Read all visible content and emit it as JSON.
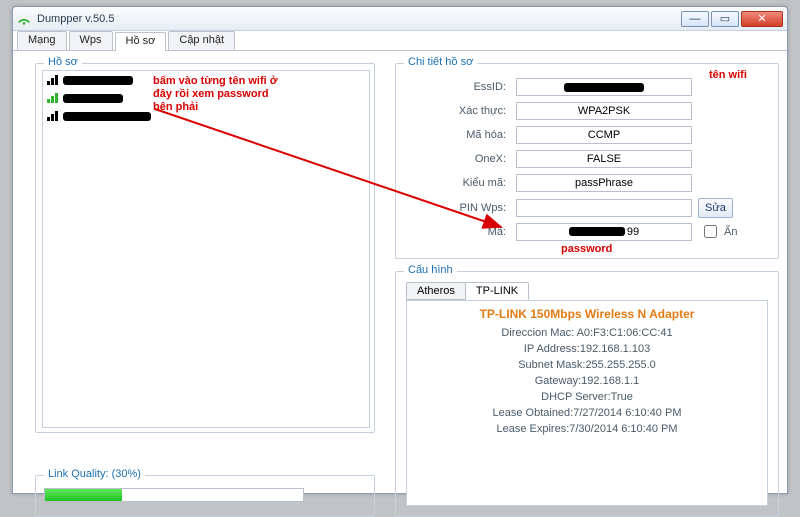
{
  "window": {
    "title": "Dumpper v.50.5"
  },
  "tabs": [
    "Mạng",
    "Wps",
    "Hồ sơ",
    "Cập nhật"
  ],
  "profilesGroup": {
    "legend": "Hồ sơ",
    "items": [
      {
        "signal": "black",
        "redact_w": 70
      },
      {
        "signal": "green",
        "redact_w": 60
      },
      {
        "signal": "black",
        "redact_w": 88
      }
    ]
  },
  "linkGroup": {
    "legend": "Link Quality: (30%)",
    "percent": 30
  },
  "details": {
    "legend": "Chi tiết hồ sơ",
    "fields": {
      "essid_label": "EssID:",
      "essid_redact_w": 80,
      "auth_label": "Xác thực:",
      "auth_value": "WPA2PSK",
      "enc_label": "Mã hóa:",
      "enc_value": "CCMP",
      "onex_label": "OneX:",
      "onex_value": "FALSE",
      "keytype_label": "Kiểu mã:",
      "keytype_value": "passPhrase",
      "pin_label": "PIN Wps:",
      "pin_value": "",
      "edit_btn": "Sửa",
      "pw_label": "Mã:",
      "pw_redact_w": 56,
      "pw_suffix": "99",
      "hide_chk": "Ẩn"
    }
  },
  "config": {
    "legend": "Cấu hình",
    "tabs": [
      "Atheros",
      "TP-LINK"
    ],
    "adapter_title": "TP-LINK 150Mbps Wireless N Adapter",
    "lines": [
      "Direccion Mac: A0:F3:C1:06:CC:41",
      "IP Address:192.168.1.103",
      "Subnet Mask:255.255.255.0",
      "Gateway:192.168.1.1",
      "DHCP Server:True",
      "Lease Obtained:7/27/2014 6:10:40 PM",
      "Lease Expires:7/30/2014 6:10:40 PM"
    ]
  },
  "annotations": {
    "instr": "bấm vào từng tên wifi ở\nđây rồi xem password\nbên phải",
    "ten_wifi": "tên wifi",
    "password": "password"
  }
}
